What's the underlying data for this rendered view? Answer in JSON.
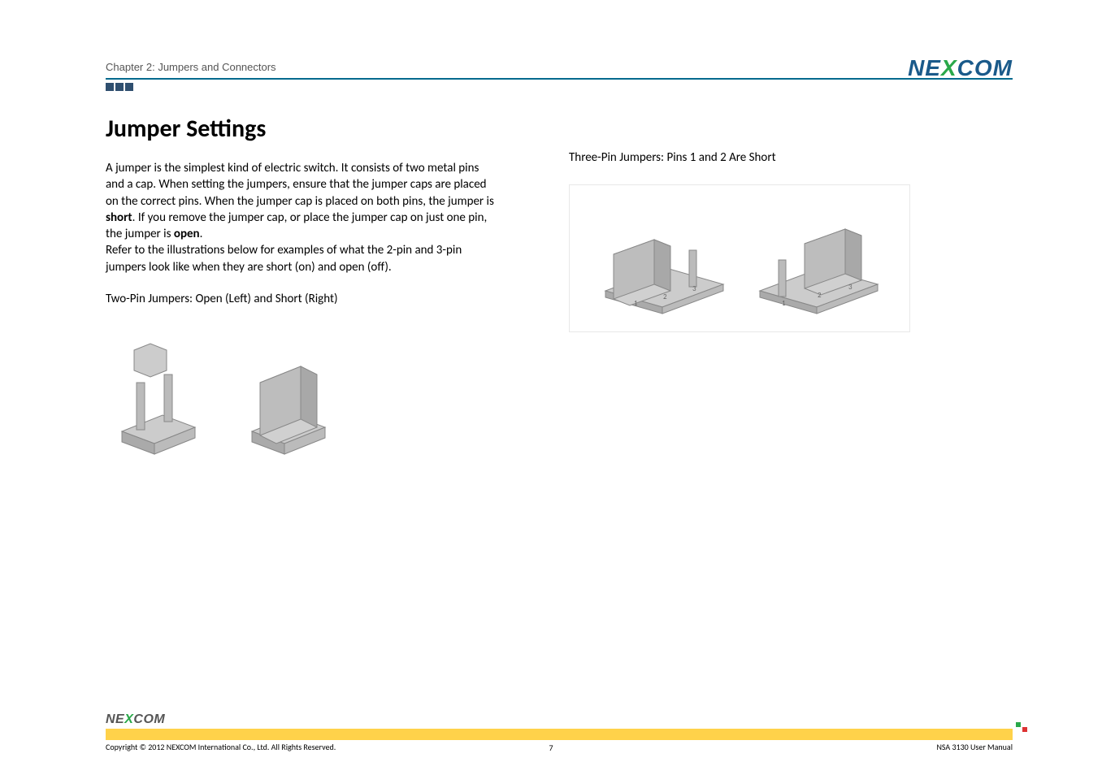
{
  "header": {
    "chapter_label": "Chapter 2: Jumpers and Connectors",
    "logo": {
      "ne": "NE",
      "x": "X",
      "com": "COM"
    }
  },
  "main": {
    "heading": "Jumper Settings",
    "paragraph_parts": {
      "p1": "A jumper is the simplest kind of electric switch. It consists of two metal pins and a cap. When setting the jumpers, ensure that the jumper caps are placed on the correct pins. When the jumper cap is placed on both pins, the jumper is ",
      "bold1": "short",
      "p2": ". If you remove the jumper cap, or place the jumper cap on just one pin, the jumper is ",
      "bold2": "open",
      "p3": ".",
      "p4": "Refer to the illustrations below for examples of what the 2-pin and 3-pin jumpers look like when they are short (on) and open (off)."
    },
    "caption_two_pin": "Two-Pin Jumpers: Open (Left) and Short (Right)",
    "caption_three_pin": "Three-Pin Jumpers: Pins 1 and 2 Are Short"
  },
  "footer": {
    "logo": {
      "ne": "NE",
      "x": "X",
      "com": "COM"
    },
    "copyright": "Copyright © 2012 NEXCOM International Co., Ltd. All Rights Reserved.",
    "page_number": "7",
    "doc_title": "NSA 3130 User Manual"
  }
}
